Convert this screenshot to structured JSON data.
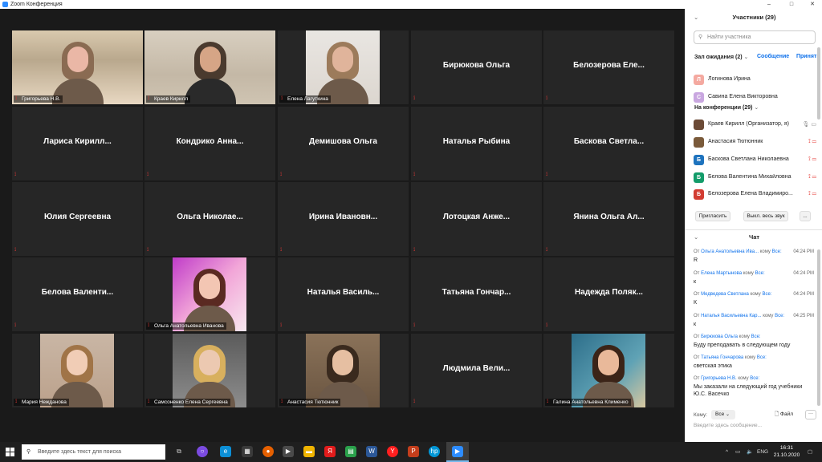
{
  "window": {
    "title": "Zoom Конференция"
  },
  "window_controls": {
    "minimize": "–",
    "maximize": "□",
    "close": "✕"
  },
  "tiles": [
    {
      "name": "Григорьева Н.В.",
      "big": "",
      "video": true
    },
    {
      "name": "Краев Кирилл",
      "big": "",
      "video": true,
      "active": true
    },
    {
      "name": "Елена Лагуткина",
      "big": "",
      "video": true
    },
    {
      "name": "",
      "big": "Бирюкова Ольга"
    },
    {
      "name": "",
      "big": "Белозерова Еле..."
    },
    {
      "name": "",
      "big": "Лариса Кирилл..."
    },
    {
      "name": "",
      "big": "Кондрико Анна..."
    },
    {
      "name": "",
      "big": "Демишова Ольга"
    },
    {
      "name": "",
      "big": "Наталья Рыбина"
    },
    {
      "name": "",
      "big": "Баскова Светла..."
    },
    {
      "name": "",
      "big": "Юлия Сергеевна"
    },
    {
      "name": "",
      "big": "Ольга Николае..."
    },
    {
      "name": "",
      "big": "Ирина Ивановн..."
    },
    {
      "name": "",
      "big": "Лотоцкая Анже..."
    },
    {
      "name": "",
      "big": "Янина Ольга Ал..."
    },
    {
      "name": "",
      "big": "Белова Валенти..."
    },
    {
      "name": "Ольга Анатольевна Иванова",
      "big": "",
      "video": true
    },
    {
      "name": "",
      "big": "Наталья Василь..."
    },
    {
      "name": "",
      "big": "Татьяна Гончар..."
    },
    {
      "name": "",
      "big": "Надежда Поляк..."
    },
    {
      "name": "Мария Нежданова",
      "big": "",
      "video": true
    },
    {
      "name": "Самсоненко Елена Сергеевна",
      "big": "",
      "video": true
    },
    {
      "name": "Анастасия Тютюнник",
      "big": "",
      "video": true
    },
    {
      "name": "",
      "big": "Людмила Вели..."
    },
    {
      "name": "Галина Анатольевна Клименко",
      "big": "",
      "video": true
    }
  ],
  "participants_panel": {
    "title": "Участники (29)",
    "search_placeholder": "Найти участника",
    "waiting_room": "Зал ожидания (2)",
    "message_link": "Сообщение",
    "admit_link": "Принять",
    "waiting": [
      {
        "name": "Логинова Ирина",
        "initial": "Л",
        "color": "#f4a9a0"
      },
      {
        "name": "Савина Елена Викторовна",
        "initial": "С",
        "color": "#c9a7e0"
      }
    ],
    "in_meeting": "На конференции (29)",
    "participants": [
      {
        "name": "Краев Кирилл (Организатор, я)",
        "initial": "",
        "color": "#6b4a36"
      },
      {
        "name": "Анастасия Тютюнник",
        "initial": "",
        "color": "#7a5a3a"
      },
      {
        "name": "Баскова Светлана Николаевна",
        "initial": "Б",
        "color": "#1e73be"
      },
      {
        "name": "Белова Валентина Михайловна",
        "initial": "Б",
        "color": "#139c6a"
      },
      {
        "name": "Белозерова Елена Владимиро...",
        "initial": "Б",
        "color": "#d23c32"
      }
    ],
    "invite_btn": "Пригласить",
    "mute_all_btn": "Выкл. весь звук",
    "more_btn": "..."
  },
  "chat": {
    "title": "Чат",
    "messages": [
      {
        "from": "Ольга Анатольевна Ива...",
        "to": "Все:",
        "time": "04:24 PM",
        "text": "R"
      },
      {
        "from": "Елена Мартынова",
        "to": "Все:",
        "time": "04:24 PM",
        "text": "к"
      },
      {
        "from": "Медведева Светлана",
        "to": "Все:",
        "time": "04:24 PM",
        "text": "К"
      },
      {
        "from": "Наталья Васильевна Кар...",
        "to": "Все:",
        "time": "04:25 PM",
        "text": "к"
      },
      {
        "from": "Бирюкова Ольга",
        "to": "Все:",
        "time": "",
        "text": "Буду преподавать в следующем году"
      },
      {
        "from": "Татьяна Гончарова",
        "to": "Все:",
        "time": "",
        "text": "светская этика"
      },
      {
        "from": "Григорьева Н.В.",
        "to": "Все:",
        "time": "",
        "text": "Мы заказали на следующий год учебники Ю.С. Васечко"
      }
    ],
    "from_word": "От",
    "to_word": "кому",
    "to_label": "Кому:",
    "to_value": "Все",
    "file_label": "Файл",
    "input_placeholder": "Введите здесь сообщение..."
  },
  "taskbar": {
    "search_placeholder": "Введите здесь текст для поиска",
    "lang": "ENG",
    "time": "16:31",
    "date": "21.10.2020"
  }
}
